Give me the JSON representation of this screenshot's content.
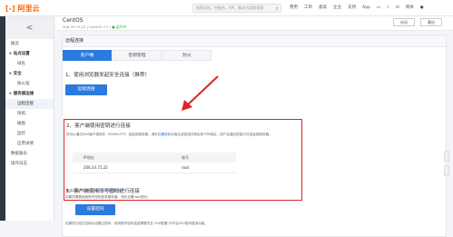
{
  "topbar": {
    "logo_mark": "[-]",
    "logo_text": "阿里云",
    "search_placeholder": "搜索文档、控制台、API、解决方案和资源",
    "nav": [
      "费用",
      "工单",
      "备案",
      "企业",
      "支持",
      "App"
    ]
  },
  "instance": {
    "title": "CentOS",
    "sub_prefix": "206.33.75.22 | CentOS 7.3 | ",
    "status": "● 运行中",
    "btn_start": "启动",
    "btn_restart": "重启"
  },
  "sidebar": {
    "back": "<",
    "items": [
      {
        "label": "概览",
        "type": "item"
      },
      {
        "label": "站点设置",
        "type": "group"
      },
      {
        "label": "域名",
        "type": "sub"
      },
      {
        "label": "安全",
        "type": "group"
      },
      {
        "label": "防火墙",
        "type": "sub"
      },
      {
        "label": "服务器运维",
        "type": "group"
      },
      {
        "label": "远程连接",
        "type": "sub",
        "active": true
      },
      {
        "label": "快照",
        "type": "sub"
      },
      {
        "label": "磁盘",
        "type": "sub"
      },
      {
        "label": "监控",
        "type": "sub"
      },
      {
        "label": "应用详情",
        "type": "sub"
      },
      {
        "label": "数据备份",
        "type": "item"
      },
      {
        "label": "操作日志",
        "type": "item"
      }
    ]
  },
  "panel": {
    "head": "远程连接",
    "tabs": [
      "客户端",
      "密钥管理",
      "防火"
    ],
    "section1": {
      "title": "1、使用浏览器发起安全连接（推荐）",
      "button": "远程连接"
    },
    "section2": {
      "title": "2、客户端使用密钥进行连接",
      "desc_prefix": "您可以通过SSH客户端软件（SSHPuTTY）连接到服务器，请在",
      "desc_link": "设置密码",
      "desc_suffix": "页面生成密钥并绑定到下列地址，用户名通过密钥方式连接到服务器。",
      "table_headers": [
        "IP地址",
        "账号"
      ],
      "table_rows": [
        [
          "206.33.75.22",
          "root"
        ]
      ],
      "footer_prefix": "具体连接方法可以参考：",
      "footer_link": "SSH配置说明"
    },
    "section3": {
      "title": "3、客户端使用账号密码进行连接",
      "desc": "如果您需要使用账号密码登录服务器，请先设置root密码。",
      "button": "设置密码",
      "footer": "如果您已经在控制台设置过密码，使用账号密码连接需要先在 SSH配置 中开启SSH密码登录功能。"
    }
  },
  "colors": {
    "brand": "#ff6a00",
    "primary": "#2a7ae0",
    "highlight": "#e02424"
  }
}
